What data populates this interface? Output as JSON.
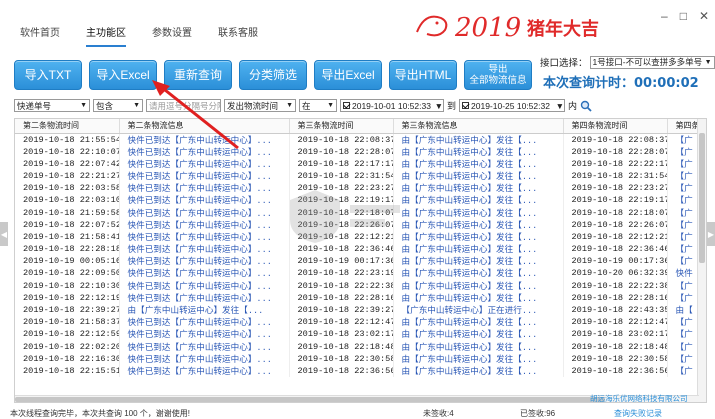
{
  "nav": {
    "items": [
      "软件首页",
      "主功能区",
      "参数设置",
      "联系客服"
    ],
    "active_index": 1
  },
  "logo": {
    "text": "2019猪年大吉"
  },
  "window": {
    "controls": [
      "–",
      "□",
      "✕"
    ]
  },
  "toolbar": {
    "buttons": [
      "导入TXT",
      "导入Excel",
      "重新查询",
      "分类筛选",
      "导出Excel",
      "导出HTML"
    ],
    "export_all_line1": "导出",
    "export_all_line2": "全部物流信息"
  },
  "iface": {
    "label": "接口选择：",
    "value": "1号接口-不可以查拼多多单号"
  },
  "timer": {
    "label": "本次查询计时：",
    "value": "00:00:02"
  },
  "filters": {
    "field": "快递单号",
    "op": "包含",
    "placeholder": "请用逗号分隔号分隔",
    "time_field": "发出物流时间",
    "time_op": "在",
    "date_from": "2019-10-01 10:52:33",
    "to_label": "到",
    "date_to": "2019-10-25 10:52:32",
    "within_label": "内"
  },
  "table": {
    "headers": [
      "第二条物流时间",
      "第二条物流信息",
      "第三条物流时间",
      "第三条物流信息",
      "第四条物流时间",
      "第四条"
    ],
    "rows": [
      [
        "2019-10-18 21:55:54",
        "快件已到达【广东中山转运中心】...",
        "2019-10-18 22:08:37",
        "由【广东中山转运中心】发往【...",
        "2019-10-18 22:08:37",
        "【广"
      ],
      [
        "2019-10-18 22:10:07",
        "快件已到达【广东中山转运中心】...",
        "2019-10-18 22:28:07",
        "由【广东中山转运中心】发往【...",
        "2019-10-18 22:28:07",
        "【广"
      ],
      [
        "2019-10-18 22:07:42",
        "快件已到达【广东中山转运中心】...",
        "2019-10-18 22:17:17",
        "由【广东中山转运中心】发往【...",
        "2019-10-18 22:22:17",
        "【广"
      ],
      [
        "2019-10-18 22:21:27",
        "快件已到达【广东中山转运中心】...",
        "2019-10-18 22:31:54",
        "由【广东中山转运中心】发往【...",
        "2019-10-18 22:31:54",
        "【广"
      ],
      [
        "2019-10-18 22:03:58",
        "快件已到达【广东中山转运中心】...",
        "2019-10-18 22:23:27",
        "由【广东中山转运中心】发往【...",
        "2019-10-18 22:23:27",
        "【广"
      ],
      [
        "2019-10-18 22:03:10",
        "快件已到达【广东中山转运中心】...",
        "2019-10-18 22:19:17",
        "由【广东中山转运中心】发往【...",
        "2019-10-18 22:19:17",
        "【广"
      ],
      [
        "2019-10-18 21:59:58",
        "快件已到达【广东中山转运中心】...",
        "2019-10-18 22:18:07",
        "由【广东中山转运中心】发往【...",
        "2019-10-18 22:18:07",
        "【广"
      ],
      [
        "2019-10-18 22:07:52",
        "快件已到达【广东中山转运中心】...",
        "2019-10-18 22:26:07",
        "由【广东中山转运中心】发往【...",
        "2019-10-18 22:26:07",
        "【广"
      ],
      [
        "2019-10-18 21:58:41",
        "快件已到达【广东中山转运中心】...",
        "2019-10-18 22:12:21",
        "由【广东中山转运中心】发往【...",
        "2019-10-18 22:12:21",
        "【广"
      ],
      [
        "2019-10-18 22:28:18",
        "快件已到达【广东中山转运中心】...",
        "2019-10-18 22:36:46",
        "由【广东中山转运中心】发往【...",
        "2019-10-18 22:36:46",
        "【广"
      ],
      [
        "2019-10-19 00:05:16",
        "快件已到达【广东中山转运中心】...",
        "2019-10-19 00:17:36",
        "由【广东中山转运中心】发往【...",
        "2019-10-19 00:17:36",
        "【广"
      ],
      [
        "2019-10-18 22:09:50",
        "快件已到达【广东中山转运中心】...",
        "2019-10-18 22:23:19",
        "由【广东中山转运中心】发往【...",
        "2019-10-20 06:32:39",
        "快件"
      ],
      [
        "2019-10-18 22:10:30",
        "快件已到达【广东中山转运中心】...",
        "2019-10-18 22:22:38",
        "由【广东中山转运中心】发往【...",
        "2019-10-18 22:22:38",
        "【广"
      ],
      [
        "2019-10-18 22:12:19",
        "快件已到达【广东中山转运中心】...",
        "2019-10-18 22:28:16",
        "由【广东中山转运中心】发往【...",
        "2019-10-18 22:28:16",
        "【广"
      ],
      [
        "2019-10-18 22:39:27",
        "由【广东中山转运中心】发往【...",
        "2019-10-18 22:39:27",
        "【广东中山转运中心】正在进行...",
        "2019-10-18 22:43:35",
        "由【"
      ],
      [
        "2019-10-18 21:58:37",
        "快件已到达【广东中山转运中心】...",
        "2019-10-18 22:12:47",
        "由【广东中山转运中心】发往【...",
        "2019-10-18 22:12:47",
        "【广"
      ],
      [
        "2019-10-18 22:12:59",
        "快件已到达【广东中山转运中心】...",
        "2019-10-18 23:02:17",
        "由【广东中山转运中心】发往【...",
        "2019-10-18 23:02:17",
        "【广"
      ],
      [
        "2019-10-18 22:02:20",
        "快件已到达【广东中山转运中心】...",
        "2019-10-18 22:18:48",
        "由【广东中山转运中心】发往【...",
        "2019-10-18 22:18:48",
        "【广"
      ],
      [
        "2019-10-18 22:16:30",
        "快件已到达【广东中山转运中心】...",
        "2019-10-18 22:30:58",
        "由【广东中山转运中心】发往【...",
        "2019-10-18 22:30:58",
        "【广"
      ],
      [
        "2019-10-18 22:15:51",
        "快件已到达【广东中山转运中心】...",
        "2019-10-18 22:36:56",
        "由【广东中山转运中心】发往【...",
        "2019-10-18 22:36:56",
        "【广"
      ]
    ]
  },
  "status": {
    "message": "本次线程查询完毕，本次共查询 100 个，谢谢使用!",
    "not_signed": "未签收:4",
    "signed": "已签收:96",
    "failed": "查询失败记录",
    "company": "胡远海乐优网络科技有限公司"
  },
  "colors": {
    "accent": "#2b8fd8",
    "timer": "#1f6fb8",
    "logo": "#e02a2a",
    "pointer": "#e02020"
  }
}
